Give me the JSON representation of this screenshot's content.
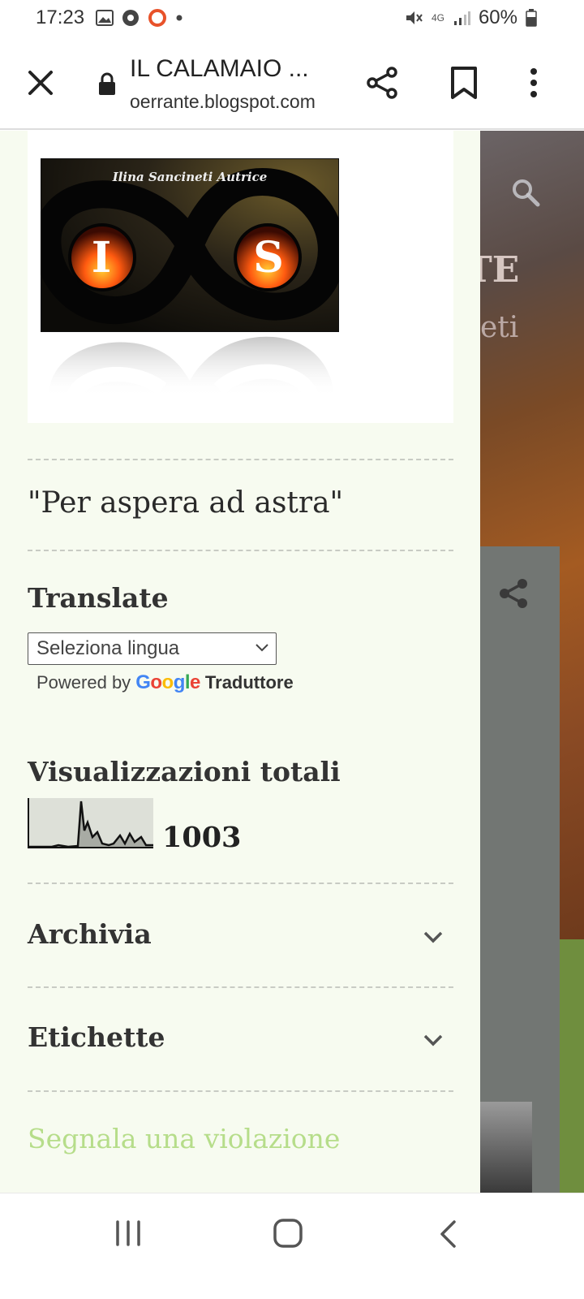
{
  "status_bar": {
    "time": "17:23",
    "network": "4G",
    "battery": "60%"
  },
  "browser": {
    "title": "IL CALAMAIO ...",
    "url": "oerrante.blogspot.com"
  },
  "background_page": {
    "heading_fragment": "TE",
    "subtitle_fragment": "eti"
  },
  "drawer": {
    "logo": {
      "caption": "Ilina Sancineti Autrice",
      "letter_left": "I",
      "letter_right": "S"
    },
    "quote": "\"Per aspera ad astra\"",
    "translate": {
      "title": "Translate",
      "select_value": "Seleziona lingua",
      "powered_by": "Powered by",
      "google": "Google",
      "service": "Traduttore"
    },
    "views": {
      "title": "Visualizzazioni totali",
      "count": "1003"
    },
    "archive_label": "Archivia",
    "labels_label": "Etichette",
    "report_link": "Segnala una violazione"
  },
  "colors": {
    "drawer_bg": "#f7fbf0",
    "link_green": "#b6dd8a",
    "heading_text": "#333333"
  },
  "icons": [
    "close-icon",
    "lock-icon",
    "share-icon",
    "bookmark-icon",
    "more-vert-icon",
    "search-icon",
    "chevron-down-icon",
    "recent-apps-icon",
    "home-icon",
    "back-icon"
  ]
}
